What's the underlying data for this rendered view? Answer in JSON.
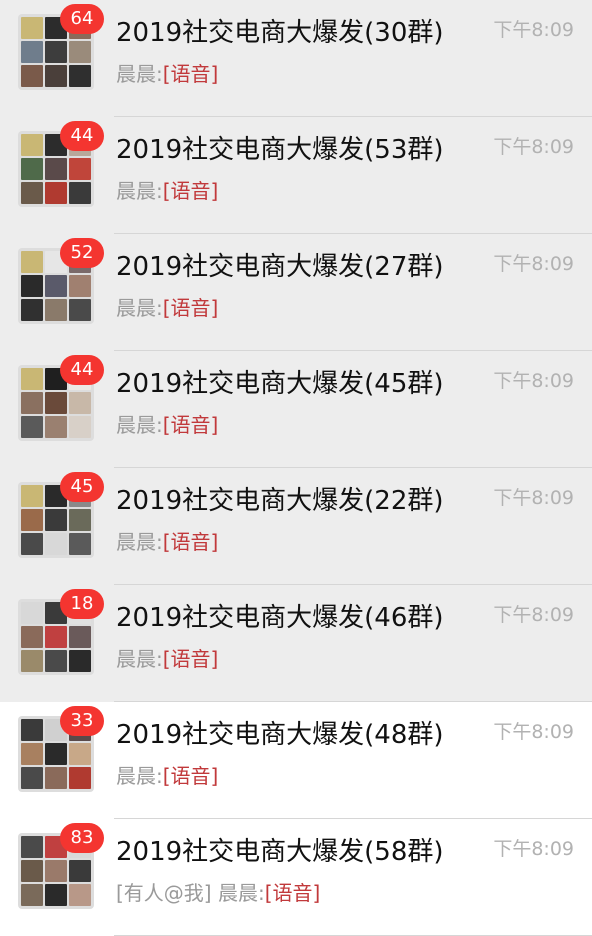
{
  "conversations": [
    {
      "badge": "64",
      "title": "2019社交电商大爆发(30群)",
      "time": "下午8:09",
      "sender": "晨晨:",
      "tag": "[语音]",
      "pinned": true
    },
    {
      "badge": "44",
      "title": "2019社交电商大爆发(53群)",
      "time": "下午8:09",
      "sender": "晨晨:",
      "tag": "[语音]",
      "pinned": true
    },
    {
      "badge": "52",
      "title": "2019社交电商大爆发(27群)",
      "time": "下午8:09",
      "sender": "晨晨:",
      "tag": "[语音]",
      "pinned": true
    },
    {
      "badge": "44",
      "title": "2019社交电商大爆发(45群)",
      "time": "下午8:09",
      "sender": "晨晨:",
      "tag": "[语音]",
      "pinned": true
    },
    {
      "badge": "45",
      "title": "2019社交电商大爆发(22群)",
      "time": "下午8:09",
      "sender": "晨晨:",
      "tag": "[语音]",
      "pinned": true
    },
    {
      "badge": "18",
      "title": "2019社交电商大爆发(46群)",
      "time": "下午8:09",
      "sender": "晨晨:",
      "tag": "[语音]",
      "pinned": true
    },
    {
      "badge": "33",
      "title": "2019社交电商大爆发(48群)",
      "time": "下午8:09",
      "sender": "晨晨:",
      "tag": "[语音]",
      "pinned": false
    },
    {
      "badge": "83",
      "title": "2019社交电商大爆发(58群)",
      "time": "下午8:09",
      "sender": "[有人@我] 晨晨:",
      "tag": "[语音]",
      "pinned": false
    }
  ],
  "colors": {
    "badge": "#f43530",
    "tag": "#c1393b",
    "pinned_bg": "#ededed",
    "normal_bg": "#ffffff"
  },
  "icons": {
    "avatar": "group-avatar-grid-icon"
  }
}
